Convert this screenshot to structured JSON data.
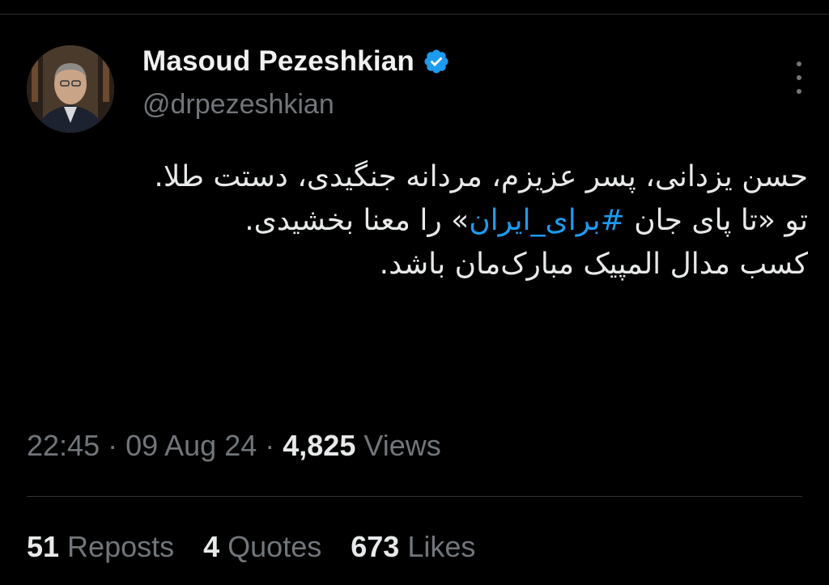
{
  "author": {
    "display_name": "Masoud Pezeshkian",
    "handle": "@drpezeshkian",
    "verified": true,
    "verified_color": "#1d9bf0"
  },
  "tweet": {
    "line1": "حسن یزدانی، پسر عزیزم، مردانه جنگیدی، دستت طلا.",
    "line2_before": "تو «تا پای جان ",
    "hashtag": "#برای_ایران",
    "line2_after": "» را معنا بخشیدی.",
    "line3": "کسب مدال المپیک مبارک‌مان باشد."
  },
  "meta": {
    "time": "22:45",
    "separator": " · ",
    "date": "09 Aug 24",
    "views_count": "4,825",
    "views_label": "Views"
  },
  "stats": {
    "reposts_count": "51",
    "reposts_label": "Reposts",
    "quotes_count": "4",
    "quotes_label": "Quotes",
    "likes_count": "673",
    "likes_label": "Likes"
  },
  "colors": {
    "background": "#000000",
    "text": "#e7e9ea",
    "secondary": "#71767b",
    "accent": "#1d9bf0"
  }
}
